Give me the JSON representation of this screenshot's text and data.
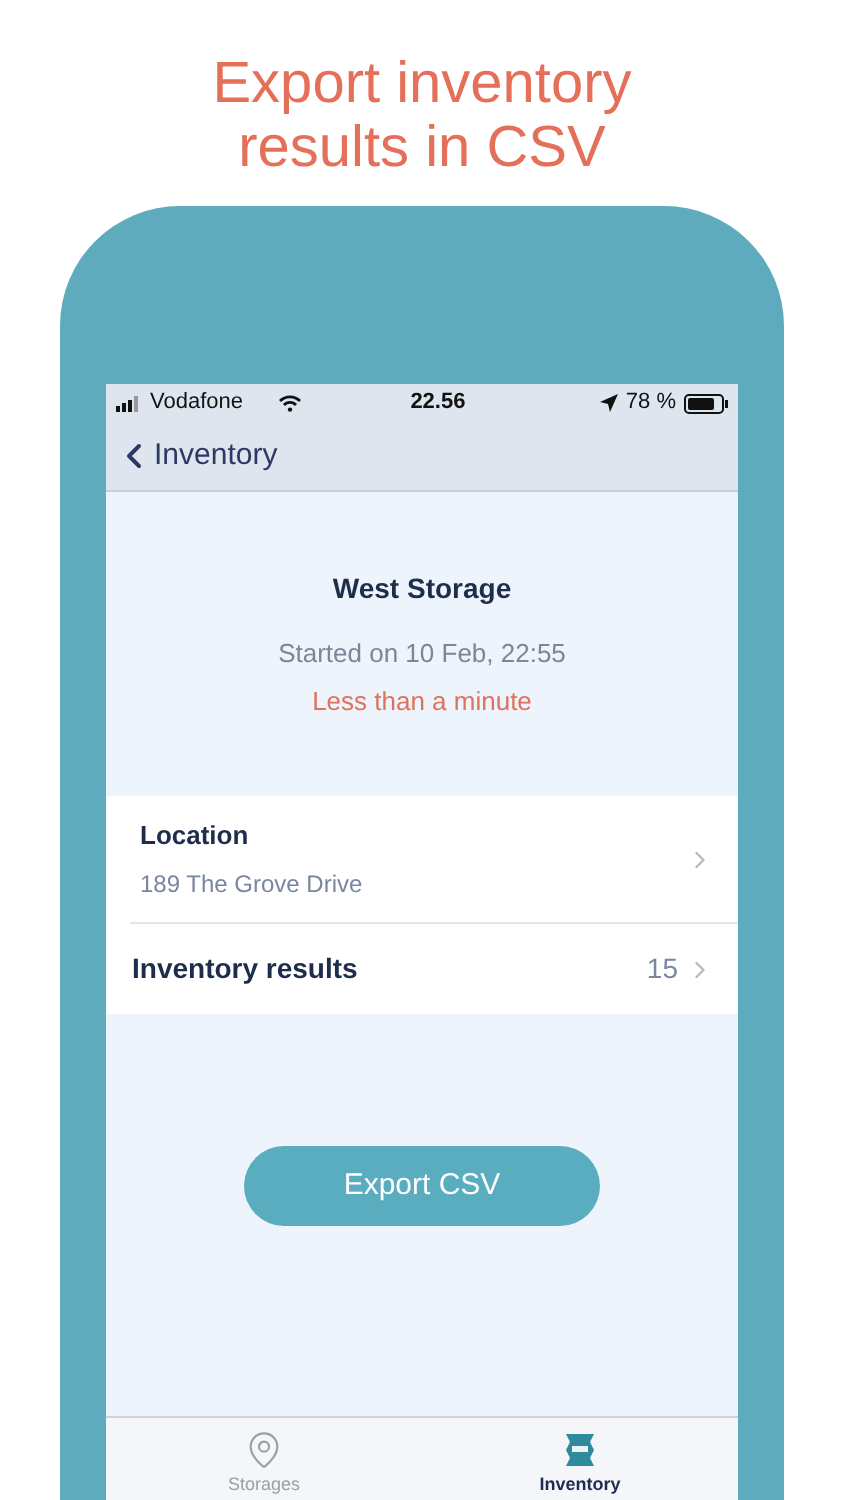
{
  "headline": "Export inventory results in CSV",
  "status_bar": {
    "carrier": "Vodafone",
    "time": "22.56",
    "battery": "78 %"
  },
  "nav": {
    "back_label": "Inventory"
  },
  "storage": {
    "name": "West Storage",
    "started": "Started on 10 Feb, 22:55",
    "duration": "Less than a minute"
  },
  "rows": [
    {
      "kind": "detail",
      "title": "Location",
      "subtitle": "189 The Grove Drive"
    },
    {
      "kind": "count",
      "title": "Inventory results",
      "value": "15"
    }
  ],
  "button": "Export CSV",
  "tabs": [
    {
      "kind": "storages",
      "label": "Storages",
      "selected": false
    },
    {
      "kind": "inventory",
      "label": "Inventory",
      "selected": true
    }
  ]
}
